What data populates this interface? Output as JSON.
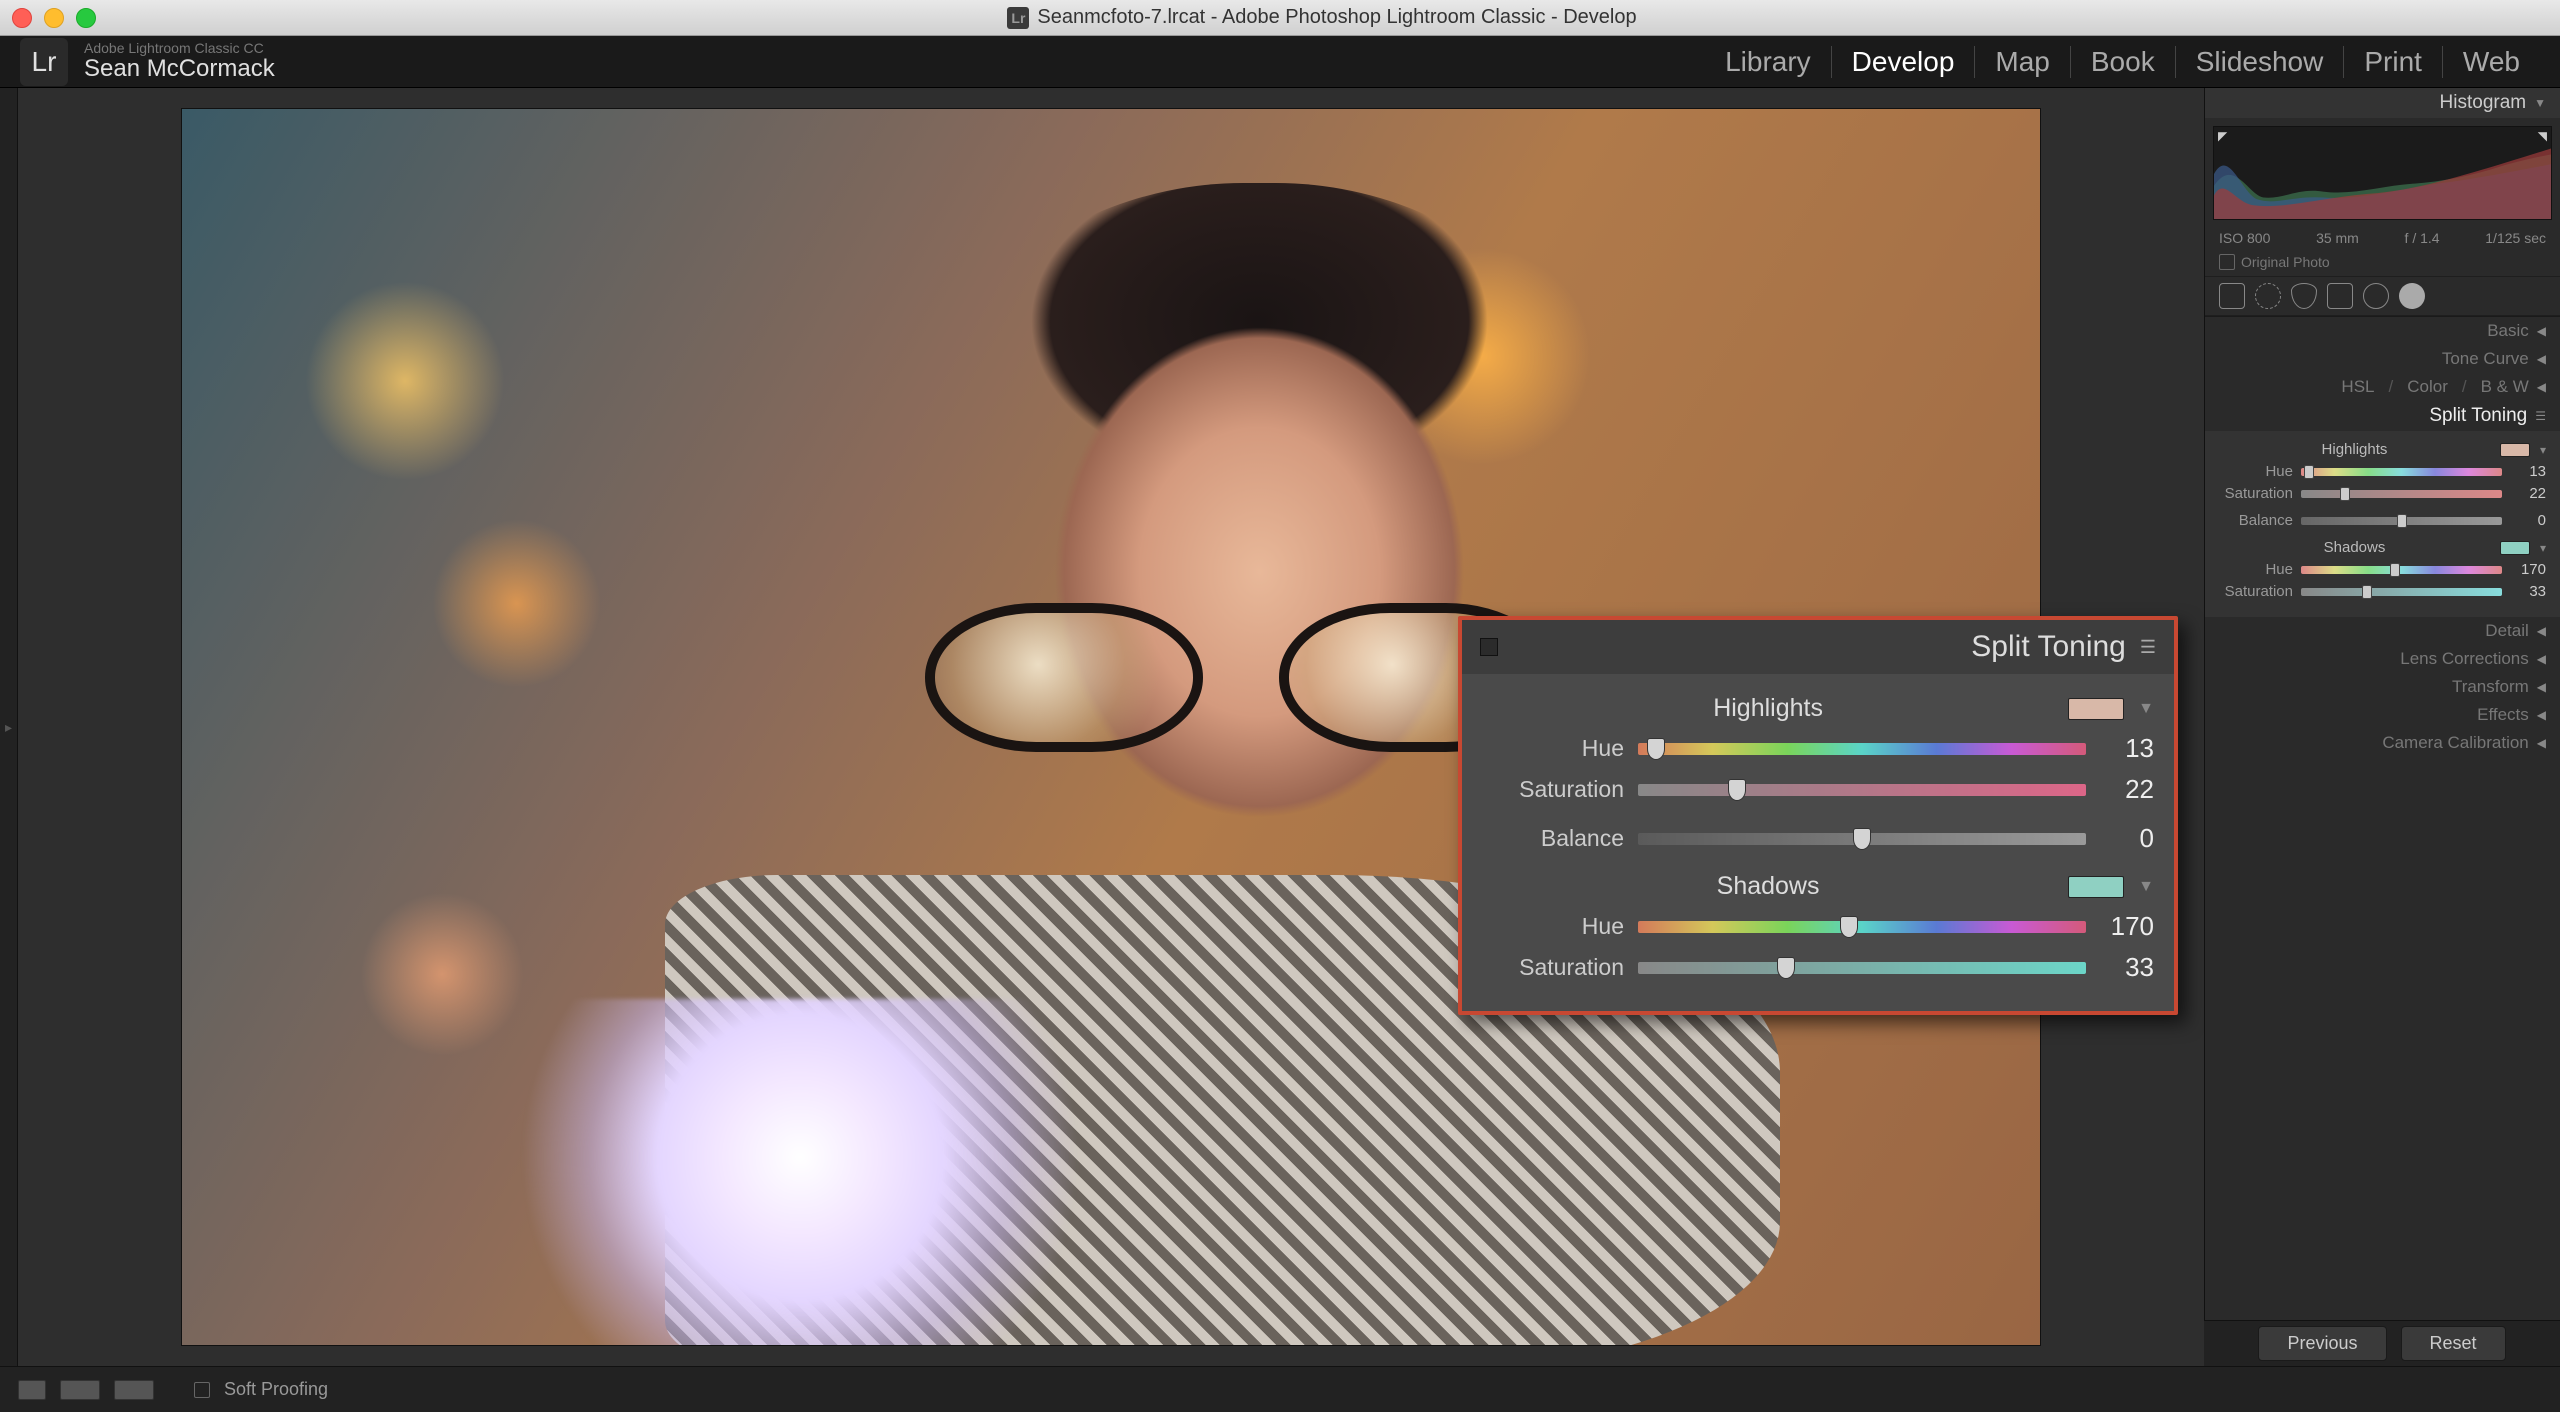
{
  "titlebar": {
    "text": "Seanmcfoto-7.lrcat - Adobe Photoshop Lightroom Classic - Develop"
  },
  "logo": {
    "small": "Adobe Lightroom Classic CC",
    "name": "Sean McCormack",
    "lr": "Lr"
  },
  "modules": {
    "library": "Library",
    "develop": "Develop",
    "map": "Map",
    "book": "Book",
    "slideshow": "Slideshow",
    "print": "Print",
    "web": "Web"
  },
  "right": {
    "histogram_title": "Histogram",
    "histo_info": {
      "iso": "ISO 800",
      "focal": "35 mm",
      "aperture": "f / 1.4",
      "shutter": "1/125 sec"
    },
    "original_photo": "Original Photo",
    "panels": {
      "basic": "Basic",
      "tone_curve": "Tone Curve",
      "hsl": "HSL",
      "color": "Color",
      "bw": "B & W",
      "split_toning": "Split Toning",
      "detail": "Detail",
      "lens": "Lens Corrections",
      "transform": "Transform",
      "effects": "Effects",
      "calibration": "Camera Calibration"
    }
  },
  "mini_st": {
    "highlights": "Highlights",
    "shadows": "Shadows",
    "hue": "Hue",
    "saturation": "Saturation",
    "balance": "Balance",
    "h_hue": "13",
    "h_sat": "22",
    "balance_v": "0",
    "s_hue": "170",
    "s_sat": "33",
    "h_swatch": "#d8b8a8",
    "s_swatch": "#8fd0c2"
  },
  "float": {
    "title": "Split Toning",
    "highlights": "Highlights",
    "shadows": "Shadows",
    "hue": "Hue",
    "saturation": "Saturation",
    "balance": "Balance",
    "h_hue": "13",
    "h_sat": "22",
    "balance_v": "0",
    "s_hue": "170",
    "s_sat": "33",
    "h_swatch": "#d8b8a8",
    "s_swatch": "#8fd0c2"
  },
  "bottom": {
    "soft_proofing": "Soft Proofing",
    "previous": "Previous",
    "reset": "Reset"
  }
}
